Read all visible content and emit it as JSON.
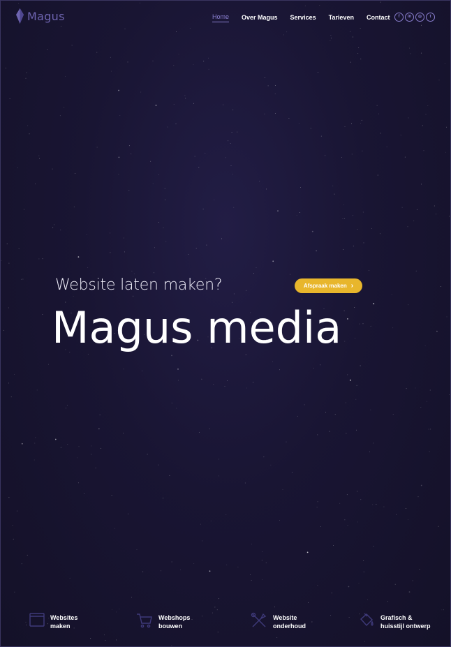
{
  "brand": {
    "name": "Magus",
    "logo_icon": "crystal-icon"
  },
  "nav": {
    "items": [
      {
        "label": "Home",
        "active": true
      },
      {
        "label": "Over Magus",
        "active": false
      },
      {
        "label": "Services",
        "active": false
      },
      {
        "label": "Tarieven",
        "active": false
      },
      {
        "label": "Contact",
        "active": false
      }
    ]
  },
  "socials": [
    {
      "name": "facebook-icon",
      "glyph": "f"
    },
    {
      "name": "linkedin-icon",
      "glyph": "in"
    },
    {
      "name": "instagram-icon",
      "glyph": "◎"
    },
    {
      "name": "twitter-icon",
      "glyph": "t"
    }
  ],
  "hero": {
    "subtitle": "Website laten maken?",
    "title": "Magus media",
    "cta_label": "Afspraak maken",
    "cta_icon": "chevron-right-icon"
  },
  "services": [
    {
      "icon": "browser-window-icon",
      "line1": "Websites",
      "line2": "maken"
    },
    {
      "icon": "shopping-cart-icon",
      "line1": "Webshops",
      "line2": "bouwen"
    },
    {
      "icon": "tools-icon",
      "line1": "Website",
      "line2": "onderhoud"
    },
    {
      "icon": "paint-bucket-icon",
      "line1": "Grafisch &",
      "line2": "huisstijl ontwerp"
    }
  ],
  "colors": {
    "background": "#191533",
    "accent": "#8a7fd0",
    "cta": "#e8b62c",
    "text": "#ffffff"
  }
}
